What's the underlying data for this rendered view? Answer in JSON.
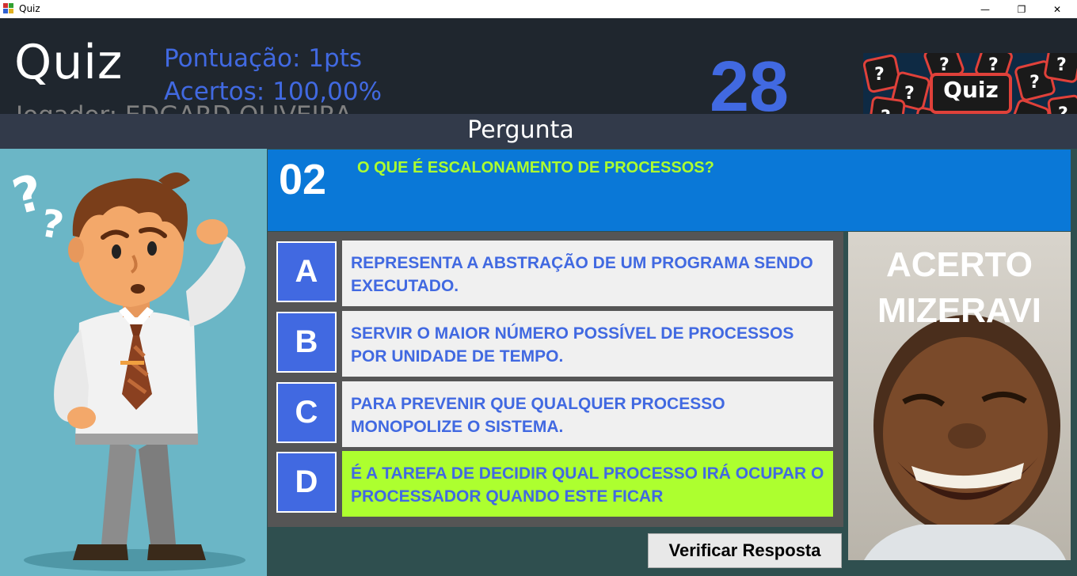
{
  "window": {
    "title": "Quiz",
    "minimize_glyph": "—",
    "maximize_glyph": "❐",
    "close_glyph": "✕"
  },
  "header": {
    "quiz_title": "Quiz",
    "score": "Pontuação: 1pts",
    "hits": "Acertos: 100,00%",
    "player": "Jogador: EDGARD OLIVEIRA",
    "timer": "28",
    "logo_text": "Quiz"
  },
  "question_section": {
    "label": "Pergunta",
    "number": "02",
    "text": "O QUE É ESCALONAMENTO DE PROCESSOS?"
  },
  "answers": [
    {
      "letter": "A",
      "text": "REPRESENTA A ABSTRAÇÃO DE UM PROGRAMA SENDO EXECUTADO.",
      "selected": false
    },
    {
      "letter": "B",
      "text": "SERVIR O MAIOR NÚMERO POSSÍVEL DE PROCESSOS POR UNIDADE DE TEMPO.",
      "selected": false
    },
    {
      "letter": "C",
      "text": "PARA PREVENIR QUE QUALQUER PROCESSO MONOPOLIZE O SISTEMA.",
      "selected": false
    },
    {
      "letter": "D",
      "text": "É A TAREFA DE DECIDIR QUAL PROCESSO IRÁ OCUPAR O PROCESSADOR QUANDO ESTE FICAR",
      "selected": true
    }
  ],
  "meme": {
    "line1": "ACERTO",
    "line2": "MIZERAVI"
  },
  "actions": {
    "verify_label": "Verificar Resposta"
  },
  "colors": {
    "accent": "#4169e1",
    "selected_answer": "#adff2f",
    "question_box": "#0a78d7",
    "header_bg": "#1f262e"
  }
}
